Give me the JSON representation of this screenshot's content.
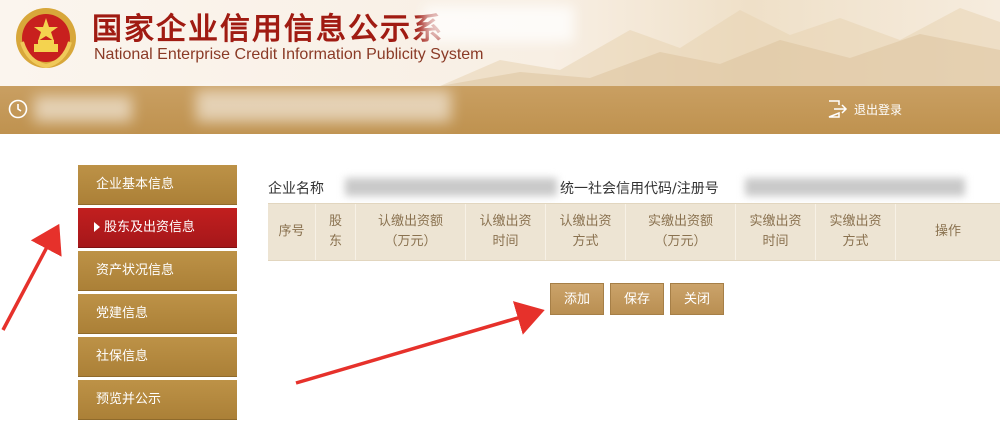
{
  "header": {
    "title_cn": "国家企业信用信息公示系",
    "title_en": "National Enterprise Credit Information Publicity System"
  },
  "topbar": {
    "logout_label": "退出登录"
  },
  "sidebar": {
    "items": [
      {
        "label": "企业基本信息",
        "active": false
      },
      {
        "label": "股东及出资信息",
        "active": true
      },
      {
        "label": "资产状况信息",
        "active": false
      },
      {
        "label": "党建信息",
        "active": false
      },
      {
        "label": "社保信息",
        "active": false
      },
      {
        "label": "预览并公示",
        "active": false
      }
    ]
  },
  "main": {
    "company_label": "企业名称",
    "code_label": "统一社会信用代码/注册号",
    "table": {
      "headers": [
        {
          "line1": "序号",
          "line2": ""
        },
        {
          "line1": "股",
          "line2": "东"
        },
        {
          "line1": "认缴出资额",
          "line2": "（万元）"
        },
        {
          "line1": "认缴出资",
          "line2": "时间"
        },
        {
          "line1": "认缴出资",
          "line2": "方式"
        },
        {
          "line1": "实缴出资额",
          "line2": "（万元）"
        },
        {
          "line1": "实缴出资",
          "line2": "时间"
        },
        {
          "line1": "实缴出资",
          "line2": "方式"
        },
        {
          "line1": "操作",
          "line2": ""
        }
      ]
    },
    "buttons": {
      "add": "添加",
      "save": "保存",
      "close": "关闭"
    }
  },
  "colors": {
    "gold": "#bf924f",
    "active_red": "#b51b1d",
    "annotation_arrow": "#e6312b",
    "table_header_bg": "#ede4d3"
  },
  "icons": [
    "national-emblem-icon",
    "clock-icon",
    "logout-icon"
  ]
}
